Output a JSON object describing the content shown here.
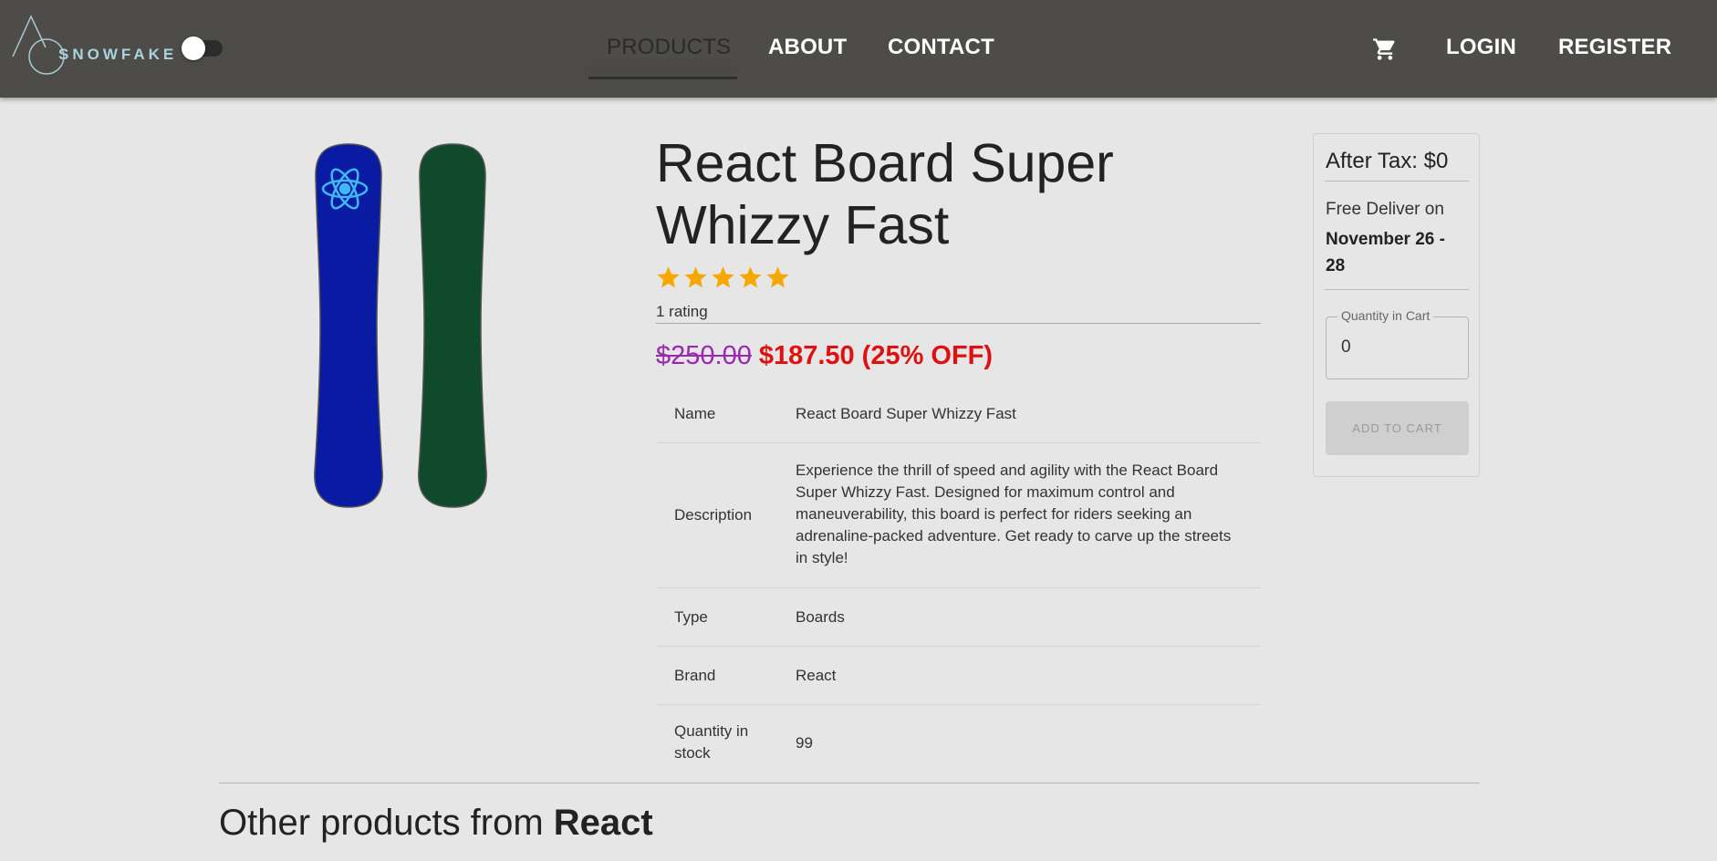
{
  "header": {
    "logo_text": "SNOWFAKE",
    "nav": {
      "products": "PRODUCTS",
      "about": "ABOUT",
      "contact": "CONTACT",
      "login": "LOGIN",
      "register": "REGISTER"
    },
    "cart_icon": "shopping-cart-icon"
  },
  "product": {
    "title": "React Board Super Whizzy Fast",
    "rating_stars": 5,
    "rating_text": "1 rating",
    "old_price": "$250.00",
    "new_price": "$187.50",
    "discount": "(25% OFF)",
    "details": [
      {
        "label": "Name",
        "value": "React Board Super Whizzy Fast"
      },
      {
        "label": "Description",
        "value": "Experience the thrill of speed and agility with the React Board Super Whizzy Fast. Designed for maximum control and maneuverability, this board is perfect for riders seeking an adrenaline-packed adventure. Get ready to carve up the streets in style!"
      },
      {
        "label": "Type",
        "value": "Boards"
      },
      {
        "label": "Brand",
        "value": "React"
      },
      {
        "label": "Quantity in stock",
        "value": "99"
      }
    ],
    "board_colors": [
      "#0a1ba3",
      "#0f4a2a"
    ]
  },
  "side_panel": {
    "after_tax": "After Tax: $0",
    "deliver_label": "Free Deliver on",
    "deliver_dates": "November 26 - 28",
    "quantity_label": "Quantity in Cart",
    "quantity_value": "0",
    "add_to_cart": "ADD TO CART"
  },
  "other_products": {
    "prefix": "Other products from ",
    "brand": "React"
  },
  "colors": {
    "header_bg": "#4d4c49",
    "page_bg": "#e6e6e6",
    "star": "#f5a800",
    "old_price": "#9c27b0",
    "sale_price": "#e01010"
  }
}
